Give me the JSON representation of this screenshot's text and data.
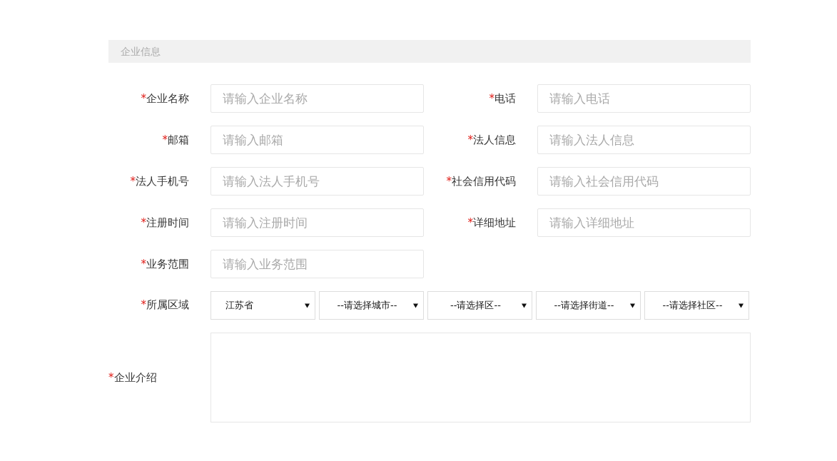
{
  "section": {
    "title": "企业信息"
  },
  "fields": [
    {
      "required_mark": "*",
      "label": "企业名称",
      "placeholder": "请输入企业名称"
    },
    {
      "required_mark": "*",
      "label": "电话",
      "placeholder": "请输入电话"
    },
    {
      "required_mark": "*",
      "label": "邮箱",
      "placeholder": "请输入邮箱"
    },
    {
      "required_mark": "*",
      "label": "法人信息",
      "placeholder": "请输入法人信息"
    },
    {
      "required_mark": "*",
      "label": "法人手机号",
      "placeholder": "请输入法人手机号"
    },
    {
      "required_mark": "*",
      "label": "社会信用代码",
      "placeholder": "请输入社会信用代码"
    },
    {
      "required_mark": "*",
      "label": "注册时间",
      "placeholder": "请输入注册时间"
    },
    {
      "required_mark": "*",
      "label": "详细地址",
      "placeholder": "请输入详细地址"
    },
    {
      "required_mark": "*",
      "label": "业务范围",
      "placeholder": "请输入业务范围"
    }
  ],
  "region": {
    "required_mark": "*",
    "label": "所属区域",
    "dropdowns": [
      {
        "value": "江苏省",
        "kind": "chosen"
      },
      {
        "value": "--请选择城市--",
        "kind": "prompt"
      },
      {
        "value": "--请选择区--",
        "kind": "prompt"
      },
      {
        "value": "--请选择街道--",
        "kind": "prompt"
      },
      {
        "value": "--请选择社区--",
        "kind": "prompt"
      }
    ]
  },
  "intro": {
    "required_mark": "*",
    "label": "企业介绍"
  }
}
